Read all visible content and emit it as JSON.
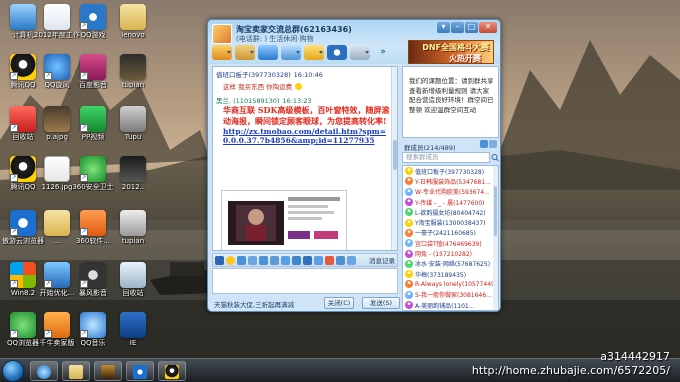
{
  "desktop": {
    "icons": [
      {
        "label": "计算机"
      },
      {
        "label": "2012年度工作总结.."
      },
      {
        "label": "QQ游戏"
      },
      {
        "label": "lenovo"
      },
      {
        "label": "腾讯QQ"
      },
      {
        "label": "QQ旋风"
      },
      {
        "label": "百度影音"
      },
      {
        "label": "tupian"
      },
      {
        "label": "回收站"
      },
      {
        "label": "p.ajpg"
      },
      {
        "label": "PP视频"
      },
      {
        "label": "Tupu"
      },
      {
        "label": "腾讯QQ"
      },
      {
        "label": "1126.jpg"
      },
      {
        "label": "360安全卫士"
      },
      {
        "label": "2012.."
      },
      {
        "label": "傲游云浏览器"
      },
      {
        "label": "..."
      },
      {
        "label": "360软件..."
      },
      {
        "label": "tupian"
      },
      {
        "label": "Win8.2"
      },
      {
        "label": "开始优化..."
      },
      {
        "label": "暴风影音"
      },
      {
        "label": "回收站"
      },
      {
        "label": "QQ浏览器"
      },
      {
        "label": "千牛卖家版"
      },
      {
        "label": "QQ音乐"
      },
      {
        "label": "IE"
      }
    ]
  },
  "qq_window": {
    "title": "淘宝卖家交流总群(62163436)",
    "subtitle": "(电话群: ) 生活休闲·购物",
    "banner_line1": "DNF全国格斗大赛",
    "banner_line2": "火热开赛",
    "messages": [
      {
        "sender": "值班口板子(397730328)",
        "time": "16:10:46"
      },
      {
        "sender": "",
        "text": "这样 我买东西 你掏运费"
      },
      {
        "sender": "黑兰. (1101589130)",
        "time": "16:13:23"
      }
    ],
    "ad_text": "华商互联 SDK高级模板，百叶窗特效，随屏滚动海报，瞬间锁定顾客眼球，为您提高转化率!",
    "ad_link": "http://zx.tmobao.com/detail.htm?spm=0.0.0.37.7b4856&amp;id=11277935",
    "input_toolbar": {
      "history_label": "消息记录"
    },
    "bottom_tip": "天猫秋装大促,三折起再满减",
    "close_button": "关闭(C)",
    "send_button": "发送(S)",
    "notice": "我们的课题位置：请到群共享查看新增级利量规则 请大家配合营造良好环境！群空间已整顿 欢迎温群空间互动",
    "members_header": "群成员(214/489)",
    "member_search_placeholder": "搜索群成员",
    "members": [
      {
        "name": "值班口板子(397730328)",
        "color": "#1a3c8a"
      },
      {
        "name": "Y-日韩服装饰品(5347681...",
        "color": "#d0201a"
      },
      {
        "name": "W-专业代购欧美(593674...",
        "color": "#d0201a"
      },
      {
        "name": "Y-传媒 - _ - 晨(1477600)",
        "color": "#d0201a"
      },
      {
        "name": "L-欲韵摄女坊(80404742)",
        "color": "#1a3c8a"
      },
      {
        "name": "Y淘宝服装(1300038437)",
        "color": "#1a3c8a"
      },
      {
        "name": "一豪子(2421160685)",
        "color": "#1a3c8a"
      },
      {
        "name": "宜口袋T恤(476469639)",
        "color": "#d0201a"
      },
      {
        "name": "网兔 - (157210282)",
        "color": "#d0201a"
      },
      {
        "name": "冰水·安装·网络(57687625)",
        "color": "#1a3c8a"
      },
      {
        "name": "华梅(373189435)",
        "color": "#1a3c8a"
      },
      {
        "name": "R-Always lonely(105774492)",
        "color": "#d0201a"
      },
      {
        "name": "S-我一般你做家(3081646...",
        "color": "#d0201a"
      },
      {
        "name": "A-美丽韵铺品(1101...",
        "color": "#1a3c8a"
      }
    ]
  },
  "watermark": {
    "user": "a314442917",
    "url": "http://home.zhubajie.com/6572205/"
  },
  "colors": {
    "window_border": "#5b8cbf",
    "titlebar": "#aed6f4",
    "ad_red": "#e3281c",
    "link_blue": "#1a3ac8",
    "sender_green": "#15804a"
  }
}
